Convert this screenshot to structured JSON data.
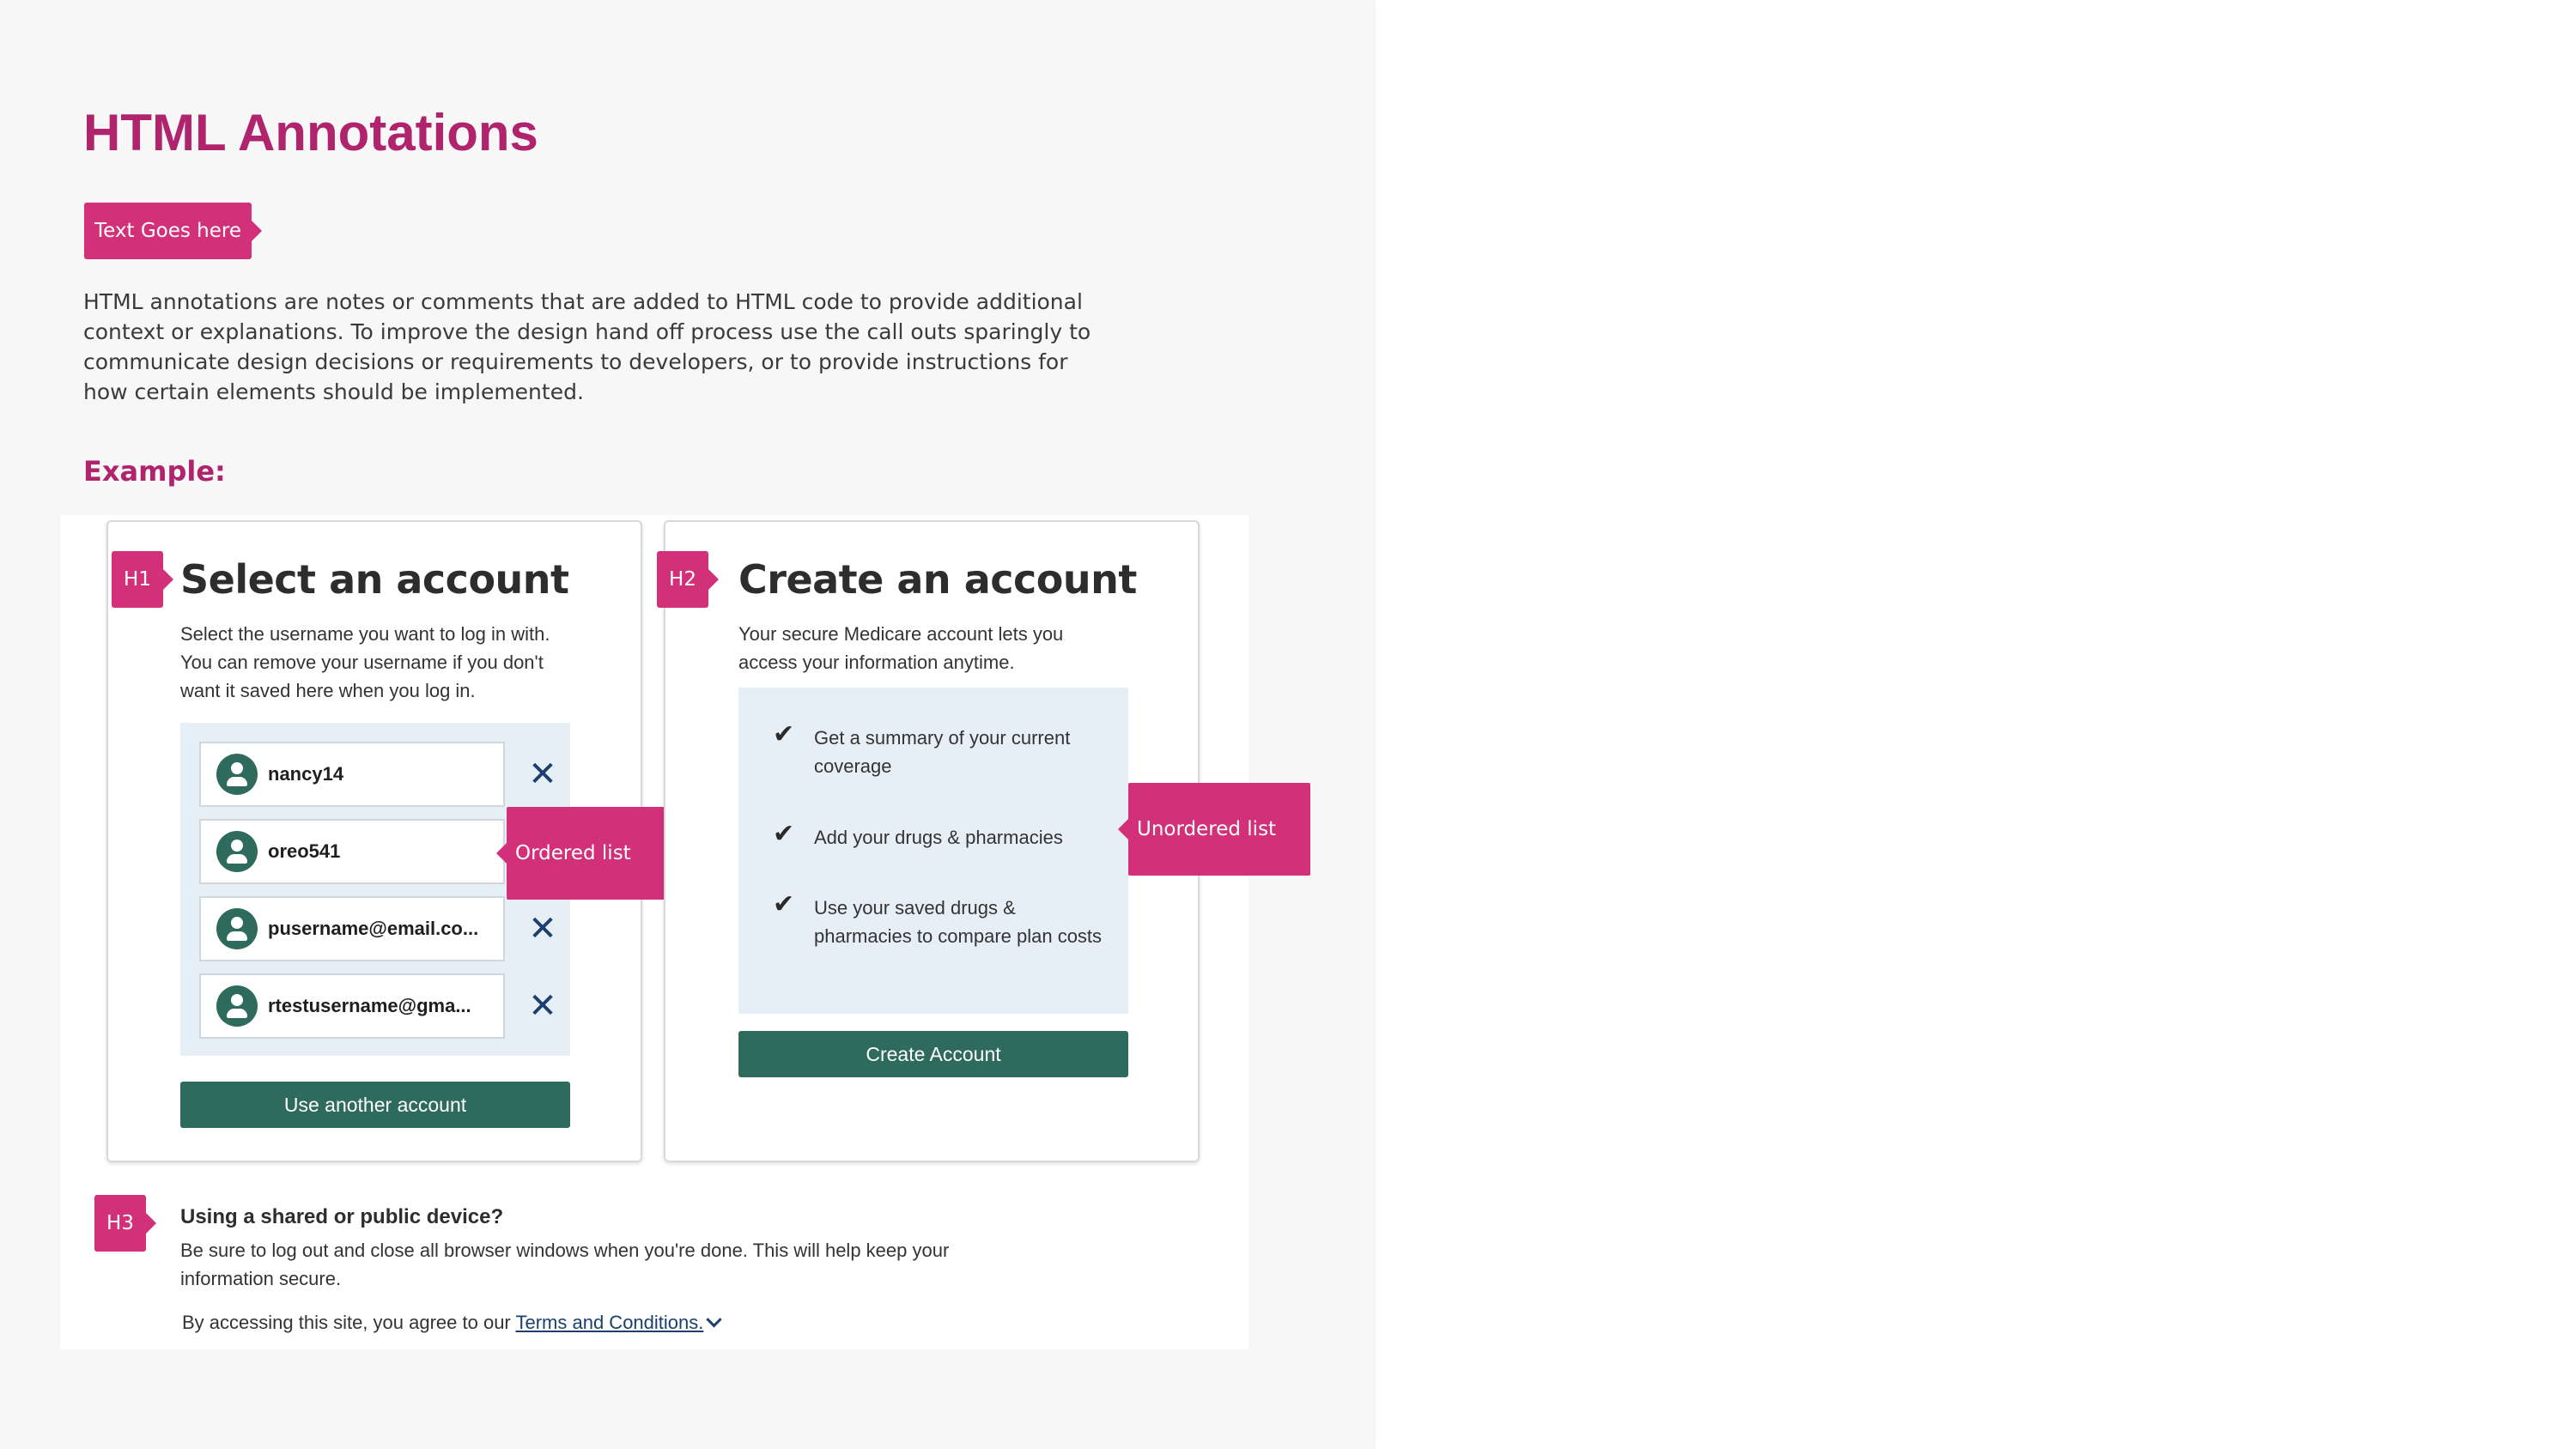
{
  "page": {
    "title": "HTML Annotations",
    "text_tag": "Text Goes here",
    "intro": "HTML annotations are notes or comments that are added to HTML code to provide additional context or explanations. To improve the design hand off process use the call outs sparingly to communicate design decisions or requirements to developers, or to provide instructions for how certain elements should be implemented.",
    "example_label": "Example:",
    "accent_color": "#b0246e",
    "tag_color": "#d3307a"
  },
  "annotations": {
    "h1": "H1",
    "h2": "H2",
    "h3": "H3",
    "ordered_list": "Ordered list",
    "unordered_list": "Unordered list"
  },
  "select_account": {
    "heading": "Select an account",
    "description": "Select the username you want to log in with. You can remove your username if you don't want it saved here when you log in.",
    "users": [
      {
        "name": "nancy14",
        "icon": "user-icon",
        "remove_icon": "close-icon"
      },
      {
        "name": "oreo541",
        "icon": "user-icon",
        "remove_icon": "close-icon"
      },
      {
        "name": "pusername@email.co...",
        "icon": "user-icon",
        "remove_icon": "close-icon"
      },
      {
        "name": "rtestusername@gma...",
        "icon": "user-icon",
        "remove_icon": "close-icon"
      }
    ],
    "button": "Use another account"
  },
  "create_account": {
    "heading": "Create an account",
    "description": "Your secure Medicare account lets you access your information anytime.",
    "benefits": [
      {
        "text": "Get a summary of your current coverage",
        "icon": "checkmark-icon"
      },
      {
        "text": "Add your drugs & pharmacies",
        "icon": "checkmark-icon"
      },
      {
        "text": "Use your saved drugs & pharmacies to compare plan costs",
        "icon": "checkmark-icon"
      }
    ],
    "button": "Create Account"
  },
  "shared_device": {
    "heading": "Using a shared or public device?",
    "description": "Be sure to log out and close all browser windows when you're done. This will help keep your information secure."
  },
  "terms": {
    "prefix": "By accessing this site, you agree to our ",
    "link": "Terms and Conditions.",
    "icon": "chevron-down-icon"
  },
  "colors": {
    "primary_button": "#2e6b5c",
    "list_background": "#e6eef6",
    "link": "#1b3f6e"
  }
}
